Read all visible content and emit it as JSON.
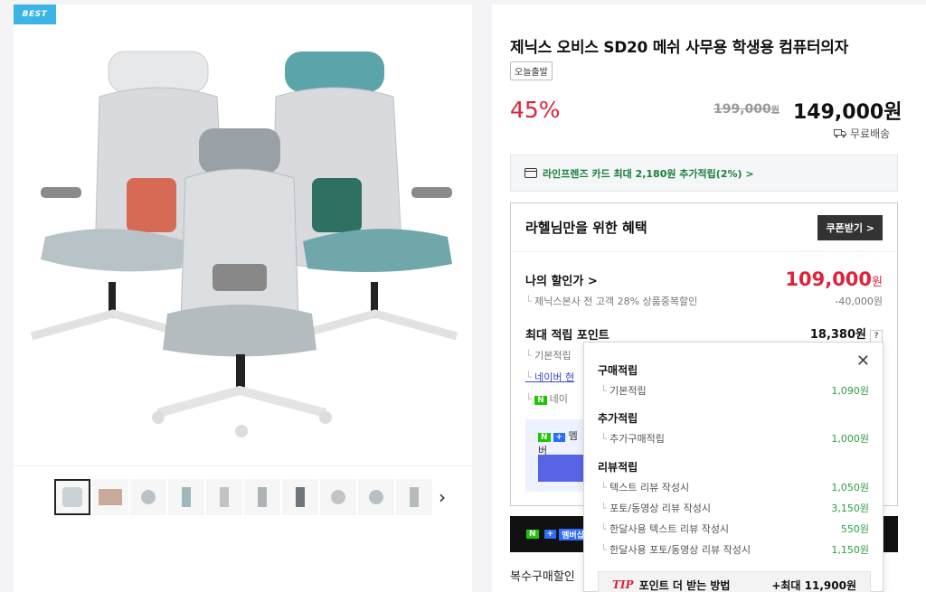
{
  "badge": "BEST",
  "product": {
    "title": "제닉스 오비스 SD20 메쉬 사무용 학생용 컴퓨터의자",
    "tag": "오늘출발",
    "discount": "45%",
    "original_price": "199,000",
    "original_unit": "원",
    "price": "149,000원",
    "shipping": "무료배송"
  },
  "card_promo": "라인프렌즈 카드 최대 2,180원 추가적립(2%) >",
  "benefit": {
    "title": "라헬님만을 위한 혜택",
    "coupon_button": "쿠폰받기 >",
    "my_discount_label": "나의 할인가 >",
    "my_discount_value": "109,000",
    "my_discount_unit": "원",
    "discount_note": "제닉스본사 전 고객 28% 상품중복할인",
    "discount_amount": "-40,000원",
    "points_label": "최대 적립 포인트",
    "points_value": "18,380원",
    "help": "?",
    "sub_items": [
      "기본적립",
      "네이버 현",
      "네이"
    ],
    "member_label": "멤버"
  },
  "blackbar_label": "멤버십",
  "multi_purchase": "복수구매할인",
  "popup": {
    "sections": [
      {
        "title": "구매적립",
        "items": [
          {
            "label": "기본적립",
            "value": "1,090원"
          }
        ]
      },
      {
        "title": "추가적립",
        "items": [
          {
            "label": "추가구매적립",
            "value": "1,000원"
          }
        ]
      },
      {
        "title": "리뷰적립",
        "items": [
          {
            "label": "텍스트 리뷰 작성시",
            "value": "1,050원"
          },
          {
            "label": "포토/동영상 리뷰 작성시",
            "value": "3,150원"
          },
          {
            "label": "한달사용 텍스트 리뷰 작성시",
            "value": "550원"
          },
          {
            "label": "한달사용 포토/동영상 리뷰 작성시",
            "value": "1,150원"
          }
        ]
      }
    ],
    "tip_label": "TIP",
    "tip_text": "포인트 더 받는 방법",
    "tip_value": "+최대 11,900원"
  },
  "colors": {
    "accent_red": "#e0223a",
    "green": "#2aa043",
    "best_badge": "#3cb4e6",
    "naver_green": "#1ec800"
  }
}
